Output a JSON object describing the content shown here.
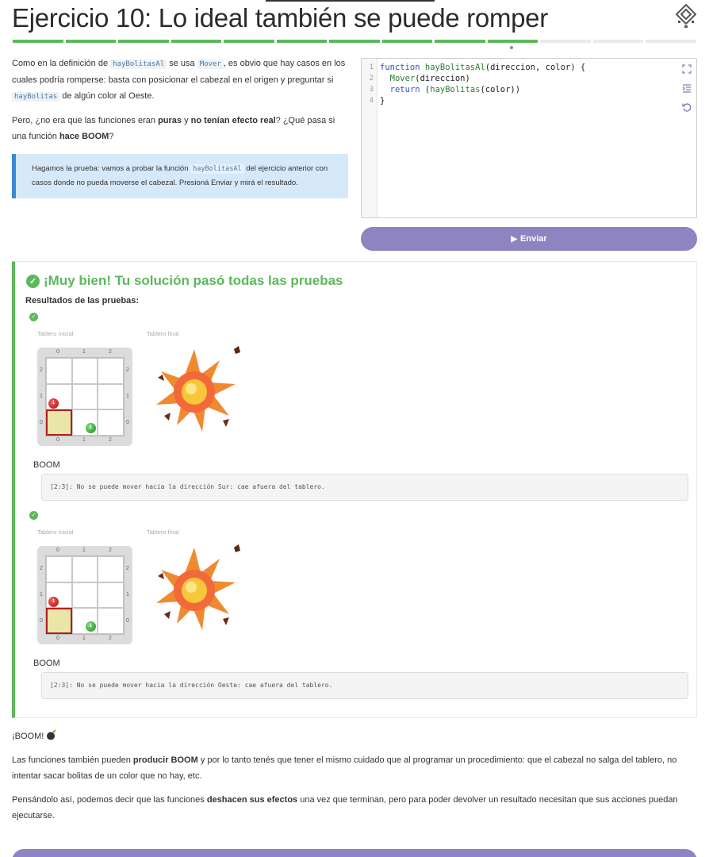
{
  "header": {
    "title": "Ejercicio 10: Lo ideal también se puede romper",
    "progress": {
      "total": 13,
      "completed": 10,
      "current": 10
    }
  },
  "description": {
    "p1_a": "Como en la definición de ",
    "p1_code1": "hayBolitasAl",
    "p1_b": " se usa ",
    "p1_code2": "Mover",
    "p1_c": ", es obvio que hay casos en los cuales podría romperse: basta con posicionar el cabezal en el origen y preguntar si ",
    "p1_code3": "hayBolitas",
    "p1_d": " de algún color al Oeste.",
    "p2_a": "Pero, ¿no era que las funciones eran ",
    "p2_b1": "puras",
    "p2_c": " y ",
    "p2_b2": "no tenían efecto real",
    "p2_d": "? ¿Qué pasa si una función ",
    "p2_b3": "hace BOOM",
    "p2_e": "?",
    "note_a": "Hagamos la prueba: vamos a probar la función ",
    "note_code": "hayBolitasAl",
    "note_b": " del ejercicio anterior con casos donde no pueda moverse el cabezal. Presioná Enviar y mirá el resultado."
  },
  "editor": {
    "lines": [
      {
        "num": "1",
        "kw": "function",
        "fn": "hayBolitasAl",
        "rest": "(direccion, color) {"
      },
      {
        "num": "2",
        "kw": "",
        "fn": "Mover",
        "rest": "(direccion)",
        "indent": "  "
      },
      {
        "num": "3",
        "kw": "return",
        "fn": "hayBolitas",
        "rest": "(color))",
        "indent": "  ",
        "pre_fn": " ("
      },
      {
        "num": "4",
        "kw": "",
        "fn": "",
        "rest": "}"
      }
    ],
    "icons": [
      "expand-icon",
      "indent-icon",
      "reset-icon"
    ]
  },
  "submit": {
    "label": "Enviar"
  },
  "results": {
    "title": "¡Muy bien! Tu solución pasó todas las pruebas",
    "subtitle": "Resultados de las pruebas:",
    "initial_label": "Tablero inicial",
    "final_label": "Tablero final",
    "tests": [
      {
        "result": "BOOM",
        "error": "[2:3]: No se puede mover hacia la dirección Sur: cae afuera del tablero."
      },
      {
        "result": "BOOM",
        "error": "[2:3]: No se puede mover hacia la dirección Oeste: cae afuera del tablero."
      }
    ],
    "board": {
      "cols": [
        "0",
        "1",
        "2"
      ],
      "rows": [
        "2",
        "1",
        "0"
      ],
      "red_count": "1",
      "green_count": "1"
    }
  },
  "after": {
    "boom_text": "¡BOOM!",
    "p2_a": "Las funciones también pueden ",
    "p2_b": "producir BOOM",
    "p2_c": " y por lo tanto tenés que tener el mismo cuidado que al programar un procedimiento: que el cabezal no salga del tablero, no intentar sacar bolitas de un color que no hay, etc.",
    "p3_a": "Pensándolo así, podemos decir que las funciones ",
    "p3_b": "deshacen sus efectos",
    "p3_c": " una vez que terminan, pero para poder devolver un resultado necesitan que sus acciones puedan ejecutarse."
  },
  "colors": {
    "success": "#5cb85c",
    "accent": "#8e84c2",
    "note_bg": "#d5e9f8",
    "note_border": "#3a8ad1"
  }
}
